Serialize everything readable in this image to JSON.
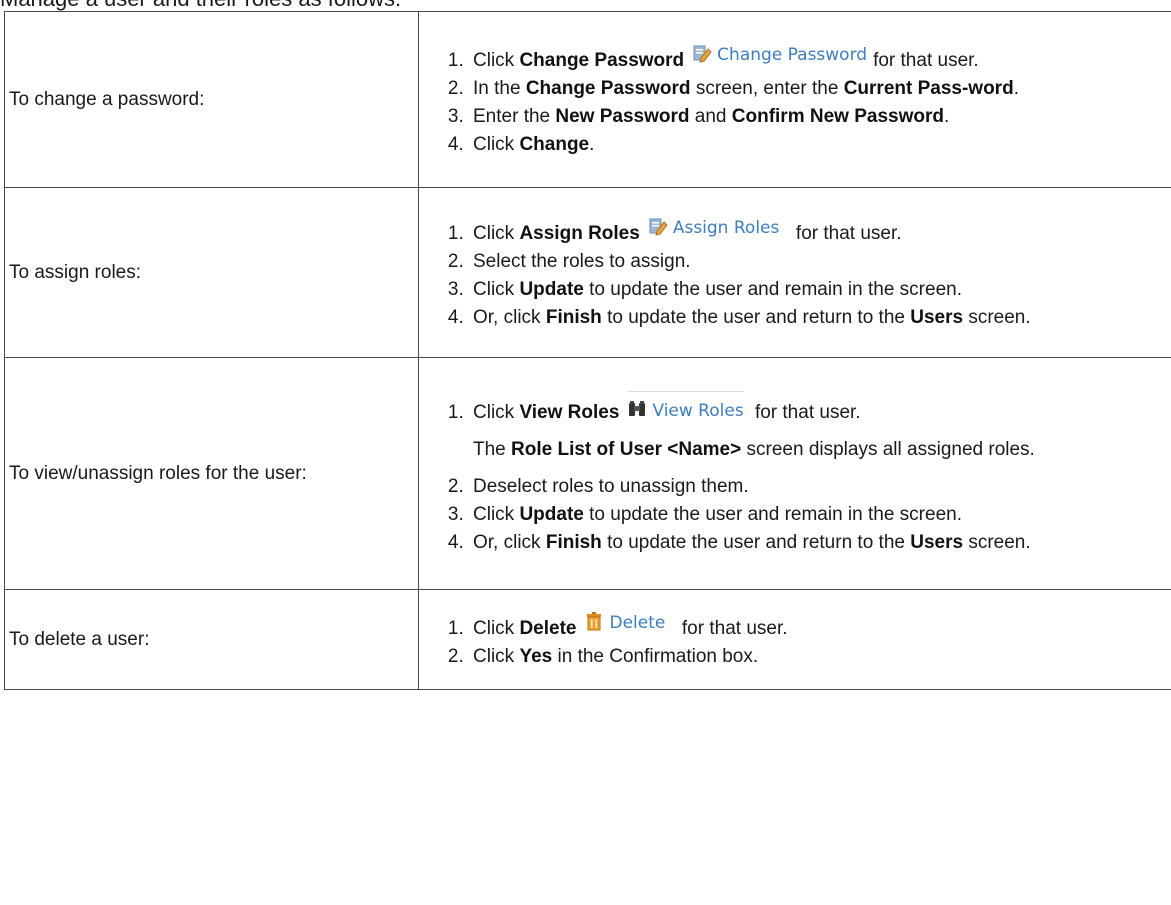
{
  "intro": "Manage a user and their roles as follows:",
  "rows": [
    {
      "label": "To change a password:",
      "steps": [
        {
          "pre": "Click ",
          "b1": "Change Password",
          "chip": "Change Password",
          "post": "for that user."
        },
        {
          "pre": "In the ",
          "b1": "Change Password",
          "mid": " screen, enter the ",
          "b2": "Current Pass-word",
          "post": "."
        },
        {
          "pre": "Enter the ",
          "b1": "New Password",
          "mid": " and ",
          "b2": "Confirm New Password",
          "post": "."
        },
        {
          "pre": "Click ",
          "b1": "Change",
          "post": "."
        }
      ]
    },
    {
      "label": "To assign roles:",
      "steps": [
        {
          "pre": "Click ",
          "b1": "Assign Roles",
          "chip": "Assign Roles",
          "post": "for that user."
        },
        {
          "pre": "Select the roles to assign."
        },
        {
          "pre": "Click ",
          "b1": "Update",
          "post": " to update the user and remain in the screen."
        },
        {
          "pre": "Or, click ",
          "b1": "Finish",
          "mid": " to update the user and return to the ",
          "b2": "Users",
          "post": " screen."
        }
      ]
    },
    {
      "label": "To view/unassign roles for the user:",
      "steps": [
        {
          "pre": "Click ",
          "b1": "View Roles",
          "chip": "View Roles",
          "post": "for that user.",
          "sub_pre": "The ",
          "sub_b": "Role List of User <Name>",
          "sub_post": " screen displays all assigned roles."
        },
        {
          "pre": "Deselect roles to unassign them."
        },
        {
          "pre": "Click ",
          "b1": "Update",
          "post": " to update the user and remain in the screen."
        },
        {
          "pre": "Or, click ",
          "b1": "Finish",
          "mid": " to update the user and return to the ",
          "b2": "Users",
          "post": " screen."
        }
      ]
    },
    {
      "label": "To delete a user:",
      "steps": [
        {
          "pre": "Click ",
          "b1": "Delete",
          "chip": "Delete",
          "post": "for that user."
        },
        {
          "pre": "Click ",
          "b1": "Yes",
          "post": " in the Confirmation box."
        }
      ]
    }
  ],
  "icons": {
    "pencil": "edit-icon",
    "binoculars": "binoculars-icon",
    "trash": "trash-icon"
  },
  "colors": {
    "link_blue": "#3a7ec8",
    "border": "#4a4a4a"
  }
}
